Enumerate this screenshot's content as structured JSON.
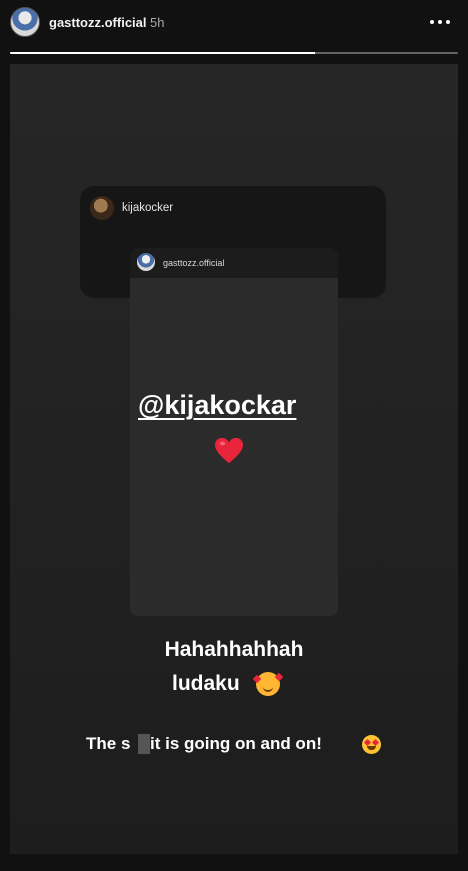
{
  "header": {
    "username": "gasttozz.official",
    "timestamp": "5h",
    "more_icon": "more-horizontal-icon"
  },
  "progress": {
    "fraction": 0.68
  },
  "shared_post": {
    "outer_username": "kijakocker",
    "inner_username": "gasttozz.official",
    "mention": "@kijakockar",
    "heart_icon": "red-heart-icon"
  },
  "caption": {
    "line1": "Hahahhahhah",
    "line2": "ludaku",
    "line2_emoji": "smiling-face-with-hearts-icon",
    "line3_start": "The s",
    "line3_censored": true,
    "line3_end": "it is going on and on!",
    "line3_emoji": "heart-eyes-icon"
  },
  "colors": {
    "background": "#111111",
    "canvas": "#242424",
    "heart": "#e8253b"
  }
}
